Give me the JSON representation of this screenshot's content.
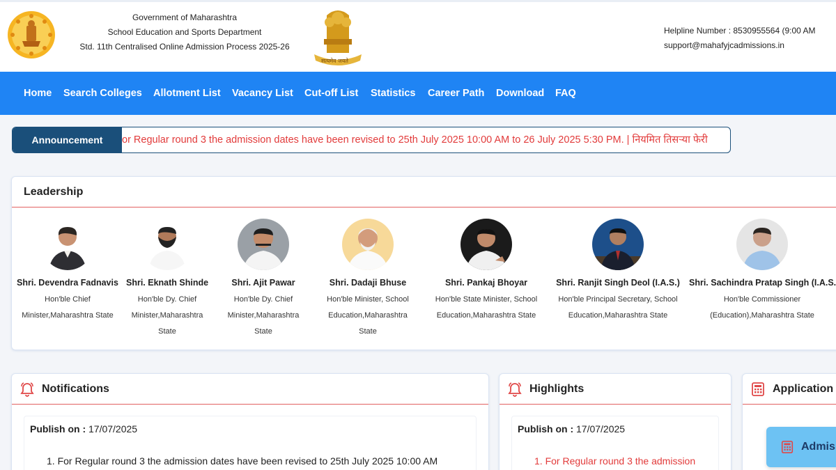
{
  "header": {
    "line1": "Government of Maharashtra",
    "line2": "School Education and Sports Department",
    "line3": "Std. 11th Centralised Online Admission Process 2025-26",
    "helpline": "Helpline Number : 8530955564 (9:00 AM",
    "email": "support@mahafyjcadmissions.in",
    "emblem_motto": "सत्यमेव जयते"
  },
  "nav": {
    "items": [
      "Home",
      "Search Colleges",
      "Allotment List",
      "Vacancy List",
      "Cut-off List",
      "Statistics",
      "Career Path",
      "Download",
      "FAQ"
    ]
  },
  "announcement": {
    "label": "Announcement",
    "text": "or Regular round 3 the admission dates have been revised to 25th July 2025 10:00 AM to 26 July 2025 5:30 PM. | नियमित तिसऱ्या फेरी"
  },
  "leadership": {
    "title": "Leadership",
    "people": [
      {
        "name": "Shri. Devendra Fadnavis",
        "role": "Hon'ble Chief Minister,Maharashtra State"
      },
      {
        "name": "Shri. Eknath Shinde",
        "role": "Hon'ble Dy. Chief Minister,Maharashtra State"
      },
      {
        "name": "Shri. Ajit Pawar",
        "role": "Hon'ble Dy. Chief Minister,Maharashtra State"
      },
      {
        "name": "Shri. Dadaji Bhuse",
        "role": "Hon'ble Minister, School Education,Maharashtra State"
      },
      {
        "name": "Shri. Pankaj Bhoyar",
        "role": "Hon'ble State Minister, School Education,Maharashtra State"
      },
      {
        "name": "Shri. Ranjit Singh Deol (I.A.S.)",
        "role": "Hon'ble Principal Secretary, School Education,Maharashtra State"
      },
      {
        "name": "Shri. Sachindra Pratap Singh (I.A.S.)",
        "role": "Hon'ble Commissioner (Education),Maharashtra State"
      }
    ]
  },
  "notifications": {
    "title": "Notifications",
    "publish_label": "Publish on :",
    "publish_date": "17/07/2025",
    "item1": "1. For Regular round 3 the admission dates have been revised to 25th July 2025 10:00 AM"
  },
  "highlights": {
    "title": "Highlights",
    "publish_label": "Publish on :",
    "publish_date": "17/07/2025",
    "item1": "1. For Regular round 3 the admission"
  },
  "application": {
    "title": "Application",
    "button_label": "Admis"
  },
  "colors": {
    "nav_bg": "#1f84f4",
    "announce_bg": "#1a4f7a",
    "accent_red": "#e23b3b"
  }
}
